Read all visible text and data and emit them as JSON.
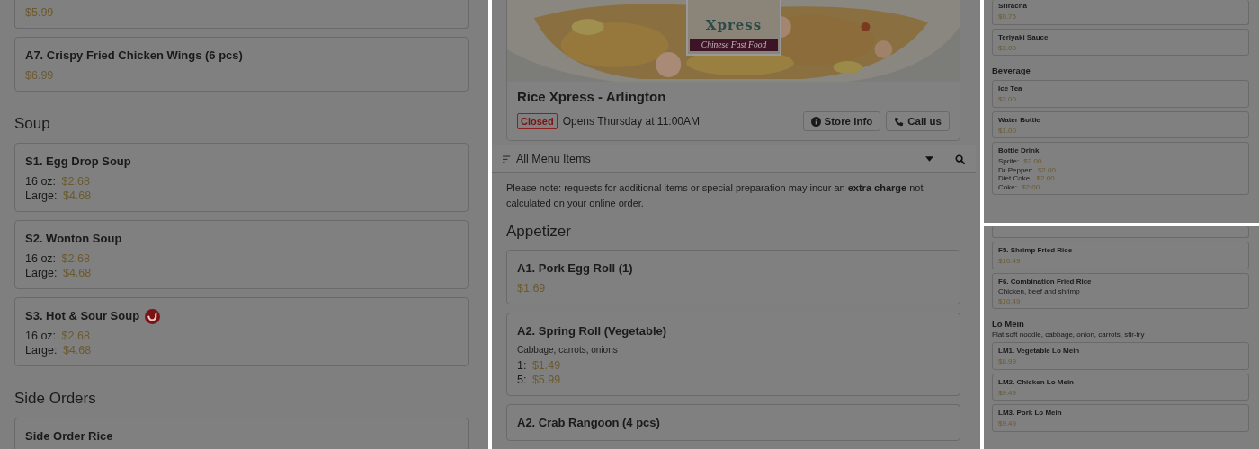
{
  "left_column": {
    "sections": [
      {
        "items": [
          {
            "kind": "cut-top",
            "spicy": false,
            "prices": [
              {
                "price": "$5.99"
              }
            ]
          },
          {
            "kind": "full",
            "name": "A7. Crispy Fried Chicken Wings (6 pcs)",
            "spicy": false,
            "prices": [
              {
                "price": "$6.99"
              }
            ]
          }
        ]
      },
      {
        "title": "Soup",
        "items": [
          {
            "kind": "full",
            "name": "S1. Egg Drop Soup",
            "spicy": false,
            "prices": [
              {
                "label": "16 oz:",
                "price": "$2.68"
              },
              {
                "label": "Large:",
                "price": "$4.68"
              }
            ]
          },
          {
            "kind": "full",
            "name": "S2. Wonton Soup",
            "spicy": false,
            "prices": [
              {
                "label": "16 oz:",
                "price": "$2.68"
              },
              {
                "label": "Large:",
                "price": "$4.68"
              }
            ]
          },
          {
            "kind": "full",
            "name": "S3. Hot & Sour Soup",
            "spicy": true,
            "prices": [
              {
                "label": "16 oz:",
                "price": "$2.68"
              },
              {
                "label": "Large:",
                "price": "$4.68"
              }
            ]
          }
        ]
      },
      {
        "title": "Side Orders",
        "items": [
          {
            "kind": "full",
            "name": "Side Order Rice",
            "spicy": false
          }
        ]
      }
    ]
  },
  "store": {
    "logo": {
      "brand": "Xpress",
      "tagline": "Chinese Fast Food"
    },
    "name": "Rice Xpress - Arlington",
    "status": "Closed",
    "hours": "Opens Thursday at 11:00AM",
    "buttons": [
      {
        "kind": "info",
        "label": "Store info"
      },
      {
        "kind": "phone",
        "label": "Call us"
      }
    ]
  },
  "menu_filter": {
    "value": "All Menu Items"
  },
  "note": "Please note: requests for additional items or special preparation may incur an **extra charge** not calculated on your online order.",
  "center_column": {
    "sections": [
      {
        "title": "Appetizer",
        "items": [
          {
            "kind": "full",
            "name": "A1. Pork Egg Roll (1)",
            "spicy": false,
            "prices": [
              {
                "price": "$1.69"
              }
            ]
          },
          {
            "kind": "full",
            "name": "A2. Spring Roll (Vegetable)",
            "description": "Cabbage, carrots, onions",
            "spicy": false,
            "prices": [
              {
                "label": "1:",
                "price": "$1.49"
              },
              {
                "label": "5:",
                "price": "$5.99"
              }
            ]
          },
          {
            "kind": "full",
            "name": "A2. Crab Rangoon (4 pcs)",
            "spicy": false
          }
        ]
      }
    ]
  },
  "right_top": {
    "sections": [
      {
        "items": [
          {
            "kind": "cut-top",
            "name": "Sriracha",
            "spicy": false,
            "prices": [
              {
                "price": "$0.75"
              }
            ]
          },
          {
            "kind": "full",
            "name": "Teriyaki Sauce",
            "spicy": false,
            "prices": [
              {
                "price": "$1.00"
              }
            ]
          }
        ]
      },
      {
        "title": "Beverage",
        "items": [
          {
            "kind": "full",
            "name": "Ice Tea",
            "spicy": false,
            "prices": [
              {
                "price": "$2.00"
              }
            ]
          },
          {
            "kind": "full",
            "name": "Water Bottle",
            "spicy": false,
            "prices": [
              {
                "price": "$1.00"
              }
            ]
          },
          {
            "kind": "full",
            "name": "Bottle Drink",
            "spicy": false,
            "prices": [
              {
                "label": "Sprite:",
                "price": "$2.00"
              },
              {
                "label": "Dr Pepper:",
                "price": "$2.00"
              },
              {
                "label": "Diet Coke:",
                "price": "$2.00"
              },
              {
                "label": "Coke:",
                "price": "$2.00"
              }
            ]
          }
        ]
      }
    ]
  },
  "right_bottom": {
    "sections": [
      {
        "items": [
          {
            "kind": "cut-top",
            "spicy": false
          },
          {
            "kind": "full",
            "name": "F5. Shrimp Fried Rice",
            "spicy": false,
            "prices": [
              {
                "price": "$10.49"
              }
            ]
          },
          {
            "kind": "full",
            "name": "F6. Combination Fried Rice",
            "description": "Chicken, beef and shrimp",
            "spicy": false,
            "prices": [
              {
                "price": "$10.49"
              }
            ]
          }
        ]
      },
      {
        "title": "Lo Mein",
        "description": "Flat soft noodle, cabbage, onion, carrots, stir-fry",
        "items": [
          {
            "kind": "full",
            "name": "LM1. Vegetable Lo Mein",
            "spicy": false,
            "prices": [
              {
                "price": "$8.99"
              }
            ]
          },
          {
            "kind": "full",
            "name": "LM2. Chicken Lo Mein",
            "spicy": false,
            "prices": [
              {
                "price": "$9.49"
              }
            ]
          },
          {
            "kind": "full",
            "name": "LM3. Pork Lo Mein",
            "spicy": false,
            "prices": [
              {
                "price": "$9.49"
              }
            ]
          }
        ]
      }
    ]
  }
}
